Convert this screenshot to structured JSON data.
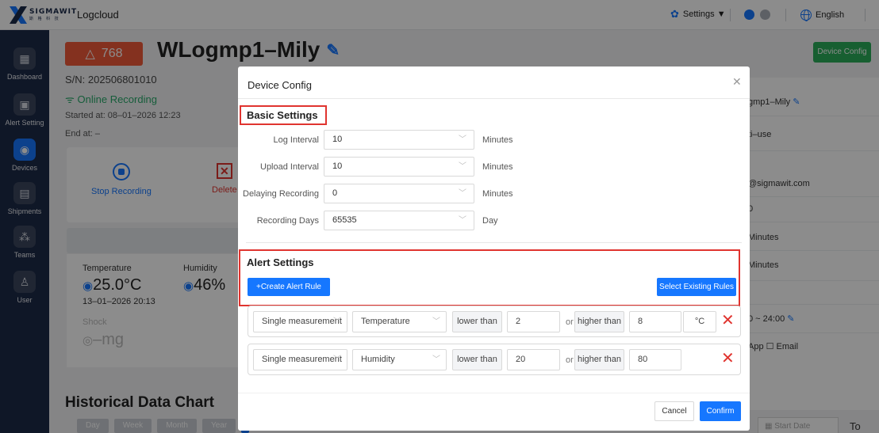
{
  "topbar": {
    "logo_text": "SIGMAWIT",
    "logo_subtext": "斯 格 科 技",
    "app_name": "Logcloud",
    "settings_label": "Settings ▼",
    "language_label": "English",
    "icons": [
      "sigmawit-logo-icon",
      "gear-icon",
      "status-dot-icon",
      "globe-icon"
    ]
  },
  "sidebar": {
    "items": [
      {
        "label": "Dashboard",
        "icon": "dashboard-icon",
        "glyph": "▦"
      },
      {
        "label": "Alert Setting",
        "icon": "alert-setting-icon",
        "glyph": "▣"
      },
      {
        "label": "Devices",
        "icon": "devices-icon",
        "glyph": "◉"
      },
      {
        "label": "Shipments",
        "icon": "shipments-icon",
        "glyph": "▤"
      },
      {
        "label": "Teams",
        "icon": "teams-icon",
        "glyph": "⁂"
      },
      {
        "label": "User",
        "icon": "user-icon",
        "glyph": "♙"
      }
    ],
    "active_index": 2
  },
  "device": {
    "alert_count": "768",
    "alert_glyph": "△",
    "name": "WLogmp1–Mily",
    "serial": "S/N: 202506801010",
    "status": "Online Recording",
    "started_at": "Started at: 08–01–2026 12:23",
    "end_at": "End at: –",
    "top_button": "Device Config"
  },
  "actions": {
    "stop_recording": "Stop Recording",
    "delete": "Delete"
  },
  "readings": {
    "temperature_label": "Temperature",
    "temperature_value": "25.0°C",
    "temperature_time": "13–01–2026 20:13",
    "humidity_label": "Humidity",
    "humidity_value": "46%",
    "shock_label": "Shock",
    "shock_value": "–mg"
  },
  "history": {
    "title": "Historical Data Chart",
    "ranges": [
      "Day",
      "Week",
      "Month",
      "Year"
    ],
    "start_date_placeholder": "Start Date",
    "to_label": "To"
  },
  "right_panel": {
    "rows": [
      "gmp1–Mily",
      "ti–use",
      "@sigmawit.com",
      "0",
      "Minutes",
      "Minutes",
      "0 ~ 24:00",
      "App   ☐ Email"
    ]
  },
  "modal": {
    "title": "Device Config",
    "basic_title": "Basic Settings",
    "fields": [
      {
        "label": "Log Interval",
        "value": "10",
        "unit": "Minutes"
      },
      {
        "label": "Upload Interval",
        "value": "10",
        "unit": "Minutes"
      },
      {
        "label": "Delaying Recording",
        "value": "0",
        "unit": "Minutes"
      },
      {
        "label": "Recording Days",
        "value": "65535",
        "unit": "Day"
      }
    ],
    "alert_title": "Alert Settings",
    "create_rule": "+Create Alert Rule",
    "select_rules": "Select Existing Rules",
    "rules": [
      {
        "mode": "Single measurement",
        "measure": "Temperature",
        "lower_label": "lower than",
        "lower": "2",
        "or": "or",
        "higher_label": "higher than",
        "higher": "8",
        "unit": "°C"
      },
      {
        "mode": "Single measurement",
        "measure": "Humidity",
        "lower_label": "lower than",
        "lower": "20",
        "or": "or",
        "higher_label": "higher than",
        "higher": "80",
        "unit": ""
      }
    ],
    "cancel": "Cancel",
    "confirm": "Confirm"
  },
  "colors": {
    "primary": "#1677ff",
    "danger": "#e0342f",
    "success": "#29a96b",
    "sidebar": "#1d2a47",
    "badge": "#f05a3a"
  }
}
